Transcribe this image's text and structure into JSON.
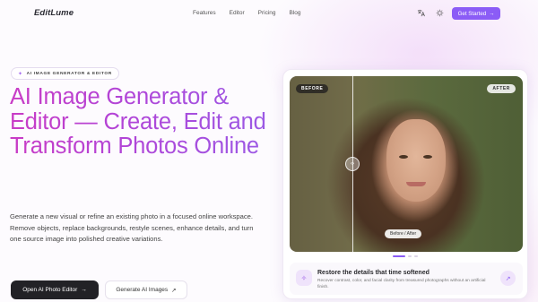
{
  "nav": {
    "logo": "EditLume",
    "links": [
      "Features",
      "Editor",
      "Pricing",
      "Blog"
    ],
    "cta_label": "Get Started",
    "cta_arrow": "→"
  },
  "hero": {
    "badge": "AI IMAGE GENERATOR & EDITOR",
    "title": "AI Image Generator & Editor — Create, Edit and Transform Photos Online",
    "description": "Generate a new visual or refine an existing photo in a focused online workspace. Remove objects, replace backgrounds, restyle scenes, enhance details, and turn one source image into polished creative variations.",
    "primary_button": "Open AI Photo Editor",
    "primary_arrow": "→",
    "secondary_button": "Generate AI Images",
    "secondary_arrow": "↗"
  },
  "showcase": {
    "before_label": "BEFORE",
    "after_label": "AFTER",
    "compare_label": "Before / After",
    "slide_count": 3,
    "active_slide": 1,
    "info_title": "Restore the details that time softened",
    "info_text": "Recover contrast, color, and facial clarity from treasured photographs without an artificial finish."
  },
  "colors": {
    "accent": "#8b5cf6",
    "title_gradient_start": "#c93cc6",
    "title_gradient_end": "#9a5be6",
    "dark_button": "#222226"
  },
  "icons": {
    "translate": "translate-icon",
    "theme": "sun-icon",
    "badge": "sparkle-icon",
    "info": "magic-wand-icon",
    "info_arrow": "arrow-up-right-icon"
  }
}
